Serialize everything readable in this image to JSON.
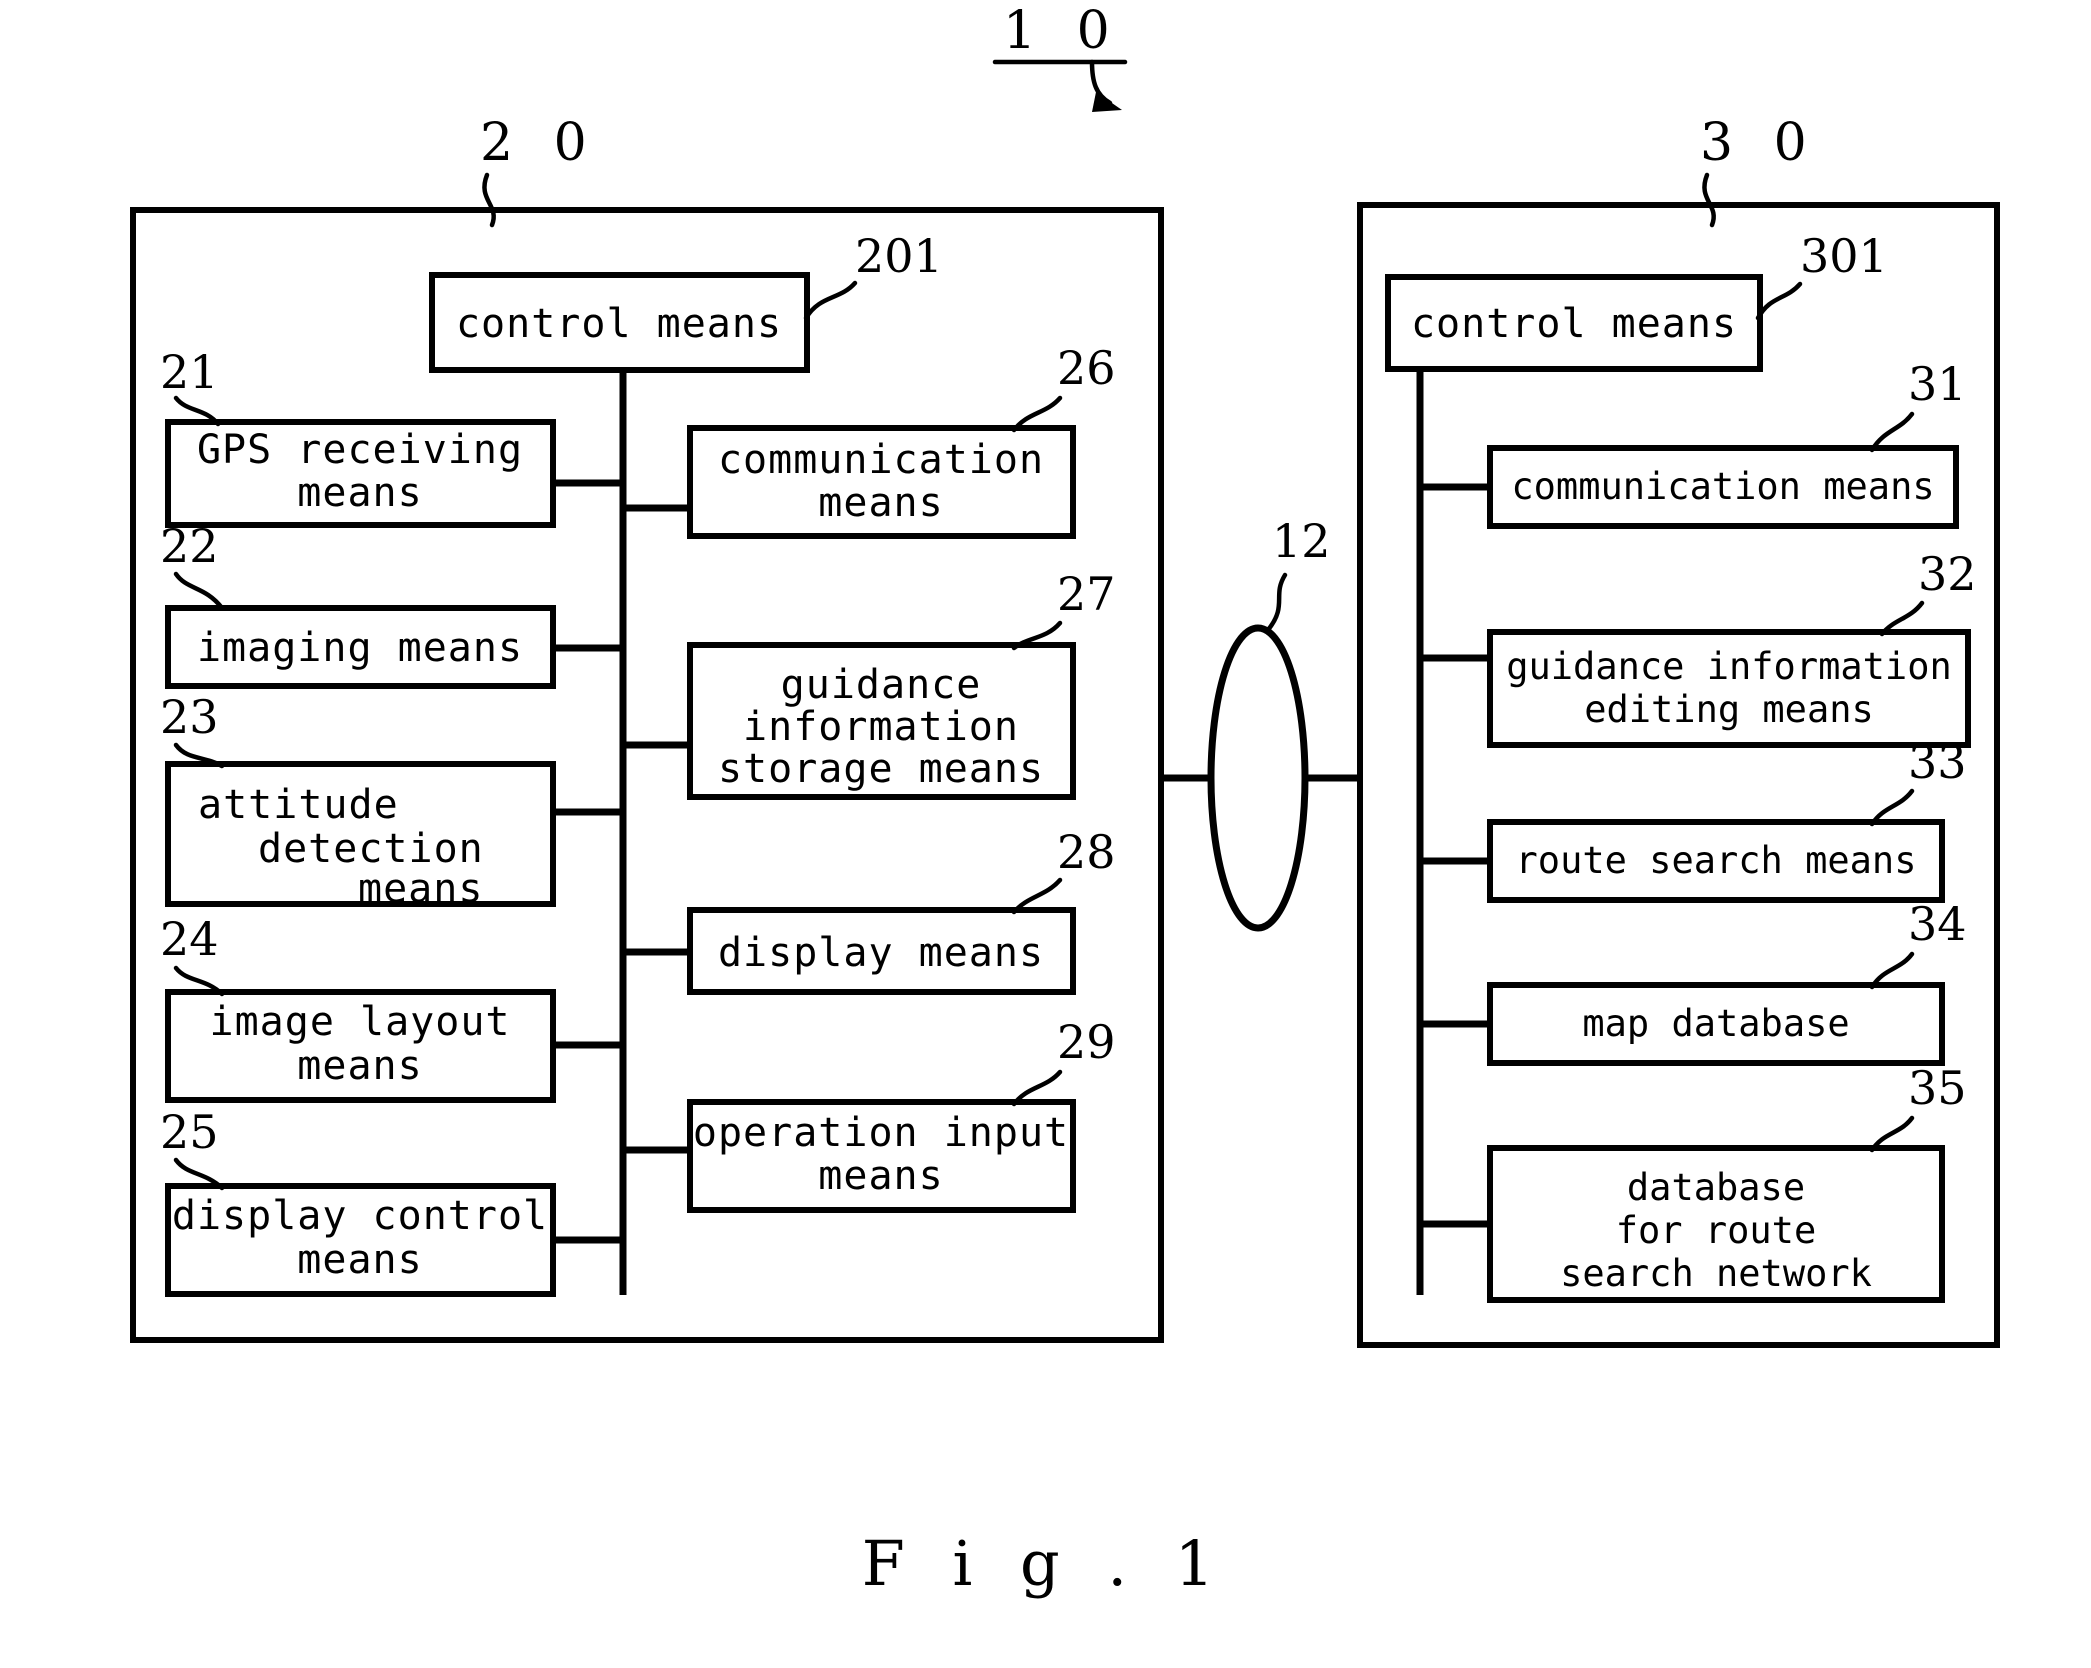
{
  "figure": {
    "caption": "F i g .  1",
    "system_ref": "1 0",
    "terminal_ref": "2 0",
    "server_ref": "3 0",
    "network_ref": "12"
  },
  "terminal": {
    "ref": "2 0",
    "control": {
      "ref": "201",
      "label": "control means"
    },
    "left_column": [
      {
        "ref": "21",
        "lines": [
          "GPS receiving",
          "means"
        ],
        "align": "center"
      },
      {
        "ref": "22",
        "lines": [
          "imaging means"
        ],
        "align": "center"
      },
      {
        "ref": "23",
        "lines": [
          "attitude",
          "detection",
          "means"
        ],
        "align": "stagger"
      },
      {
        "ref": "24",
        "lines": [
          "image layout",
          "means"
        ],
        "align": "center"
      },
      {
        "ref": "25",
        "lines": [
          "display control",
          "means"
        ],
        "align": "center"
      }
    ],
    "right_column": [
      {
        "ref": "26",
        "lines": [
          "communication",
          "means"
        ],
        "align": "center"
      },
      {
        "ref": "27",
        "lines": [
          "guidance",
          "information",
          "storage means"
        ],
        "align": "center"
      },
      {
        "ref": "28",
        "lines": [
          "display means"
        ],
        "align": "center"
      },
      {
        "ref": "29",
        "lines": [
          "operation input",
          "means"
        ],
        "align": "center"
      }
    ]
  },
  "server": {
    "ref": "3 0",
    "control": {
      "ref": "301",
      "label": "control means"
    },
    "items": [
      {
        "ref": "31",
        "lines": [
          "communication means"
        ],
        "align": "center"
      },
      {
        "ref": "32",
        "lines": [
          "guidance information",
          "editing means"
        ],
        "align": "center"
      },
      {
        "ref": "33",
        "lines": [
          "route search means"
        ],
        "align": "center"
      },
      {
        "ref": "34",
        "lines": [
          "map database"
        ],
        "align": "center"
      },
      {
        "ref": "35",
        "lines": [
          "database",
          "for route",
          "search network"
        ],
        "align": "center"
      }
    ]
  },
  "colors": {
    "ink": "#000000",
    "paper": "#ffffff"
  }
}
